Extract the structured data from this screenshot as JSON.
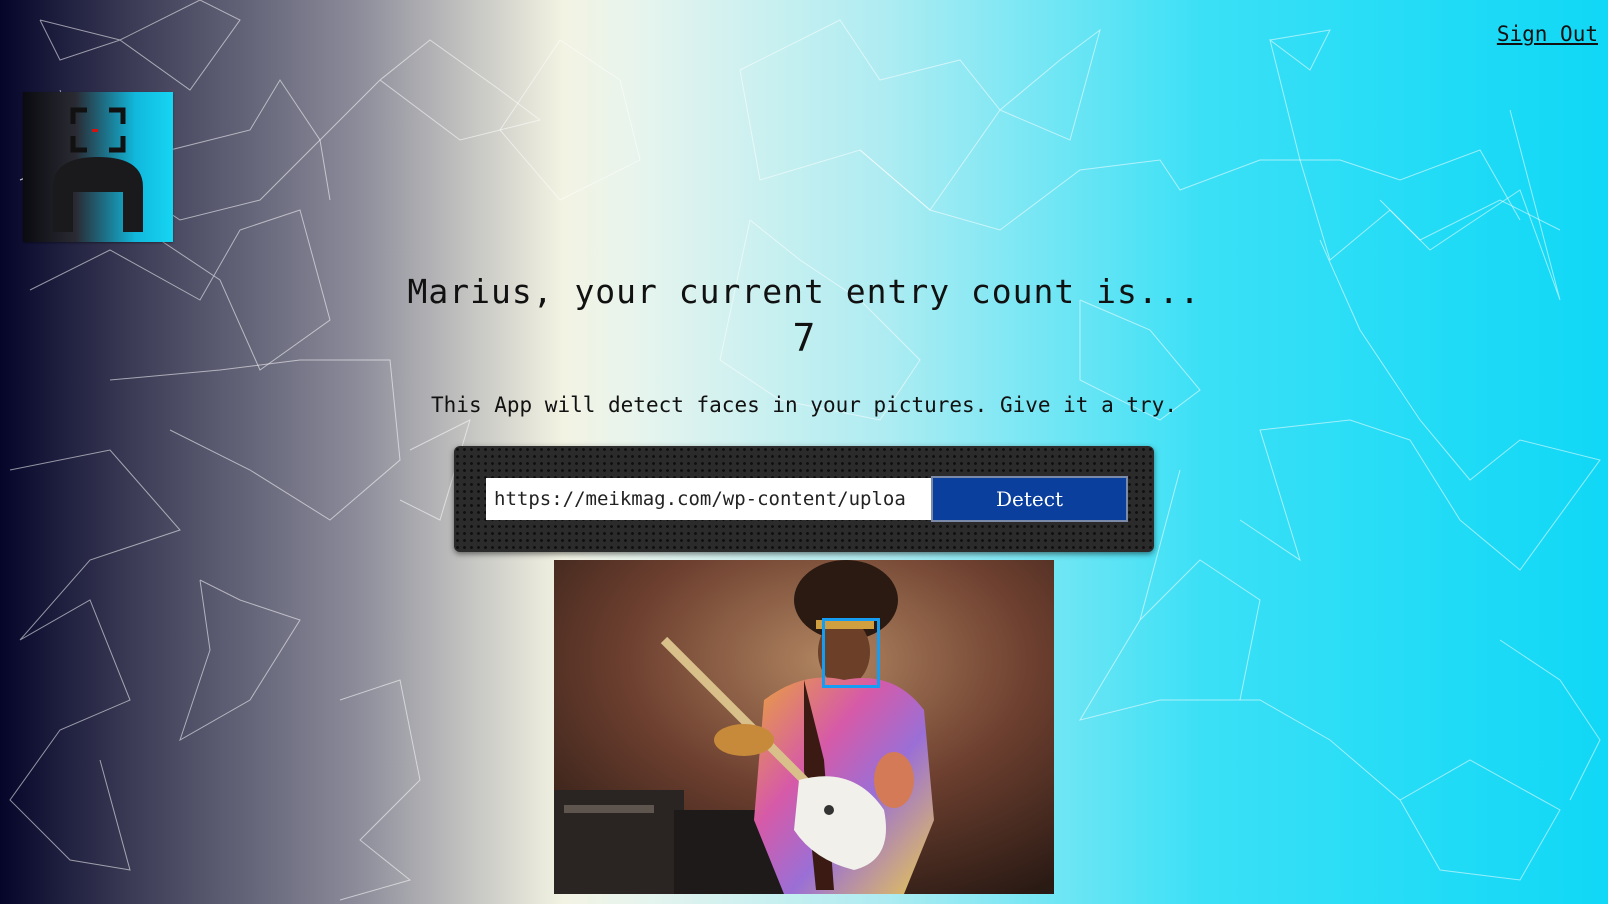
{
  "nav": {
    "sign_out": "Sign Out"
  },
  "logo": {
    "icon": "face-scan-icon"
  },
  "rank": {
    "message": "Marius, your current entry count is...",
    "count": "7"
  },
  "intro": {
    "text": "This App will detect faces in your pictures. Give it a try."
  },
  "form": {
    "url_value": "https://meikmag.com/wp-content/uploa",
    "button_label": "Detect"
  },
  "result": {
    "image_subject": "guitarist-photo",
    "faces_detected": 1
  },
  "colors": {
    "button": "#0a3f9e",
    "face_box": "#149df2",
    "panel": "#2b2b2b"
  }
}
